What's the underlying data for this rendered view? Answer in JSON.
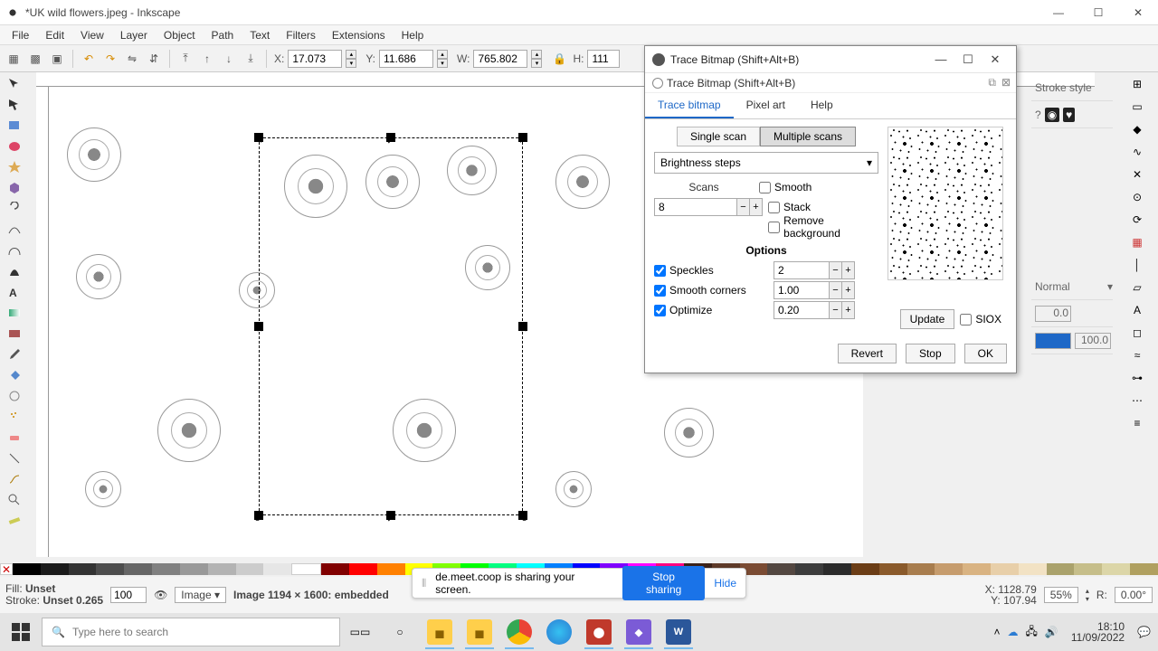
{
  "window": {
    "title": "*UK wild flowers.jpeg - Inkscape"
  },
  "menu": [
    "File",
    "Edit",
    "View",
    "Layer",
    "Object",
    "Path",
    "Text",
    "Filters",
    "Extensions",
    "Help"
  ],
  "toolbar_coords": {
    "x_label": "X:",
    "x": "17.073",
    "y_label": "Y:",
    "y": "11.686",
    "w_label": "W:",
    "w": "765.802",
    "h_label": "H:",
    "h": "111"
  },
  "right_panel": {
    "stroke_style": "Stroke style",
    "blend": "Normal",
    "values": {
      "a": "0.0",
      "b": "100.0"
    }
  },
  "dialog": {
    "title": "Trace Bitmap (Shift+Alt+B)",
    "subtitle": "Trace Bitmap (Shift+Alt+B)",
    "tabs": [
      "Trace bitmap",
      "Pixel art",
      "Help"
    ],
    "scan_toggle": [
      "Single scan",
      "Multiple scans"
    ],
    "method": "Brightness steps",
    "scans_label": "Scans",
    "scans_value": "8",
    "smooth": "Smooth",
    "stack": "Stack",
    "remove_bg": "Remove background",
    "options_title": "Options",
    "speckles": "Speckles",
    "speckles_val": "2",
    "smooth_corners": "Smooth corners",
    "smooth_val": "1.00",
    "optimize": "Optimize",
    "optimize_val": "0.20",
    "update": "Update",
    "siox": "SIOX",
    "revert": "Revert",
    "stop": "Stop",
    "ok": "OK"
  },
  "palette_colors": [
    "#000",
    "#333",
    "#666",
    "#999",
    "#ccc",
    "#800",
    "#f00",
    "#f80",
    "#ff0",
    "#8f0",
    "#0f0",
    "#0f8",
    "#0ff",
    "#08f",
    "#00f",
    "#80f",
    "#f0f",
    "#f08"
  ],
  "status": {
    "fill_label": "Fill:",
    "fill_value": "Unset",
    "stroke_label": "Stroke:",
    "stroke_value": "Unset 0.265",
    "opacity": "100",
    "layer": "Image",
    "object_info": "Image 1194 × 1600: embedded",
    "x_label": "X:",
    "x": "1128.79",
    "y_label": "Y:",
    "y": "107.94",
    "zoom": "55%",
    "r_label": "R:",
    "r": "0.00°"
  },
  "share": {
    "msg": "de.meet.coop is sharing your screen.",
    "stop": "Stop sharing",
    "hide": "Hide"
  },
  "taskbar": {
    "search_placeholder": "Type here to search",
    "time": "18:10",
    "date": "11/09/2022"
  }
}
